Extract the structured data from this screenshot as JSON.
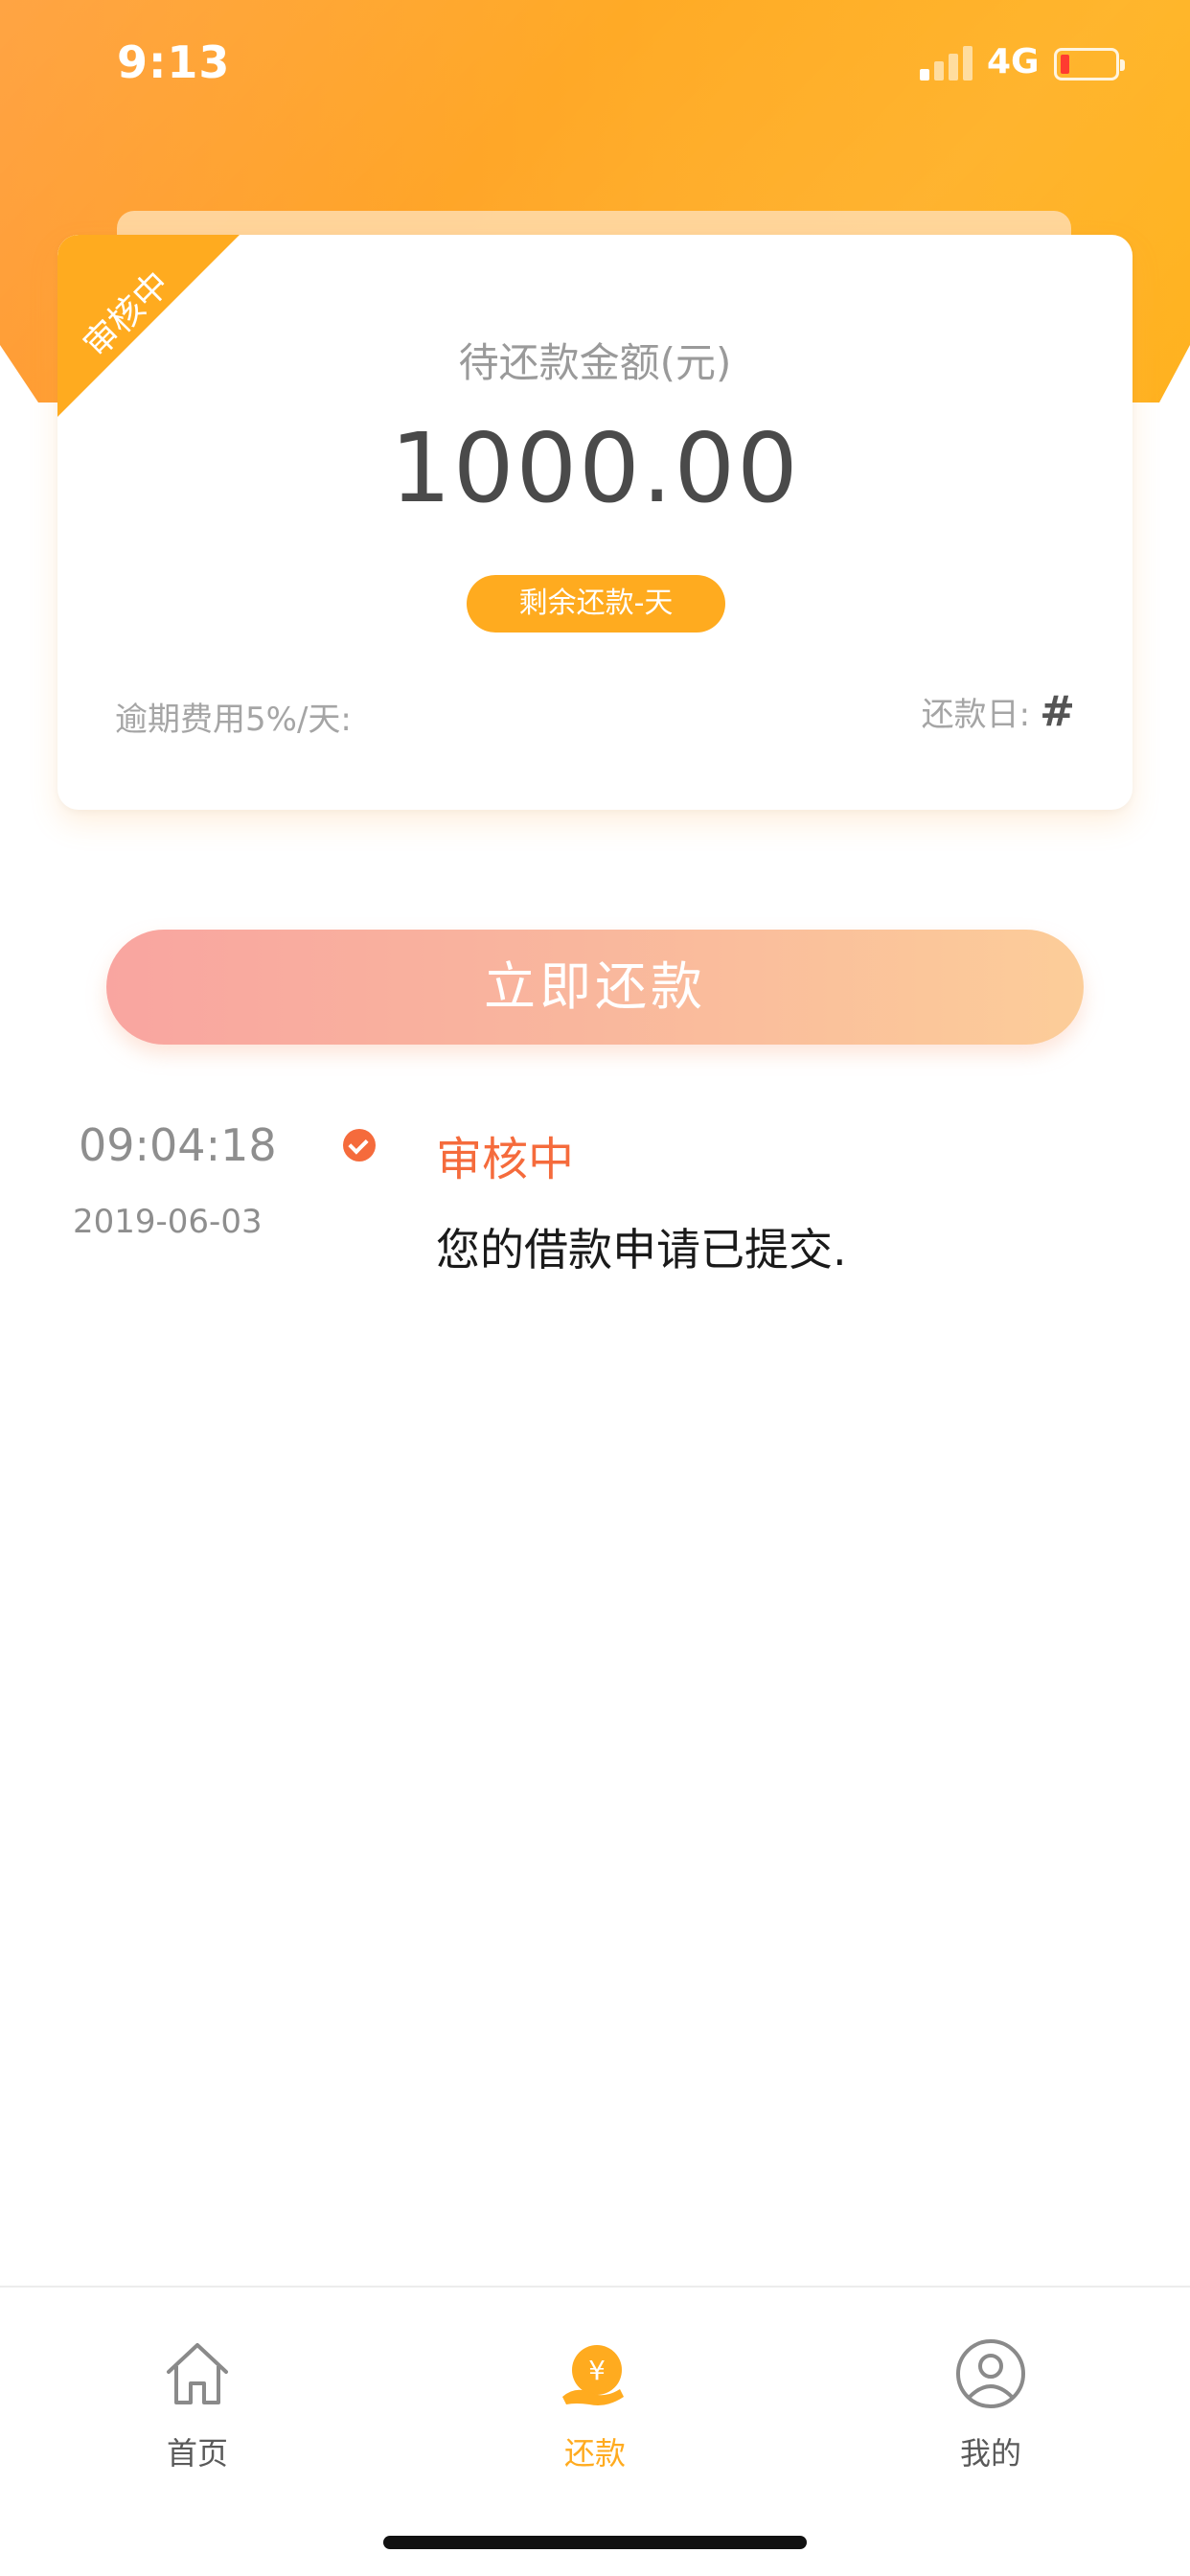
{
  "status_bar": {
    "time": "9:13",
    "network": "4G"
  },
  "card": {
    "ribbon_label": "审核中",
    "amount_label": "待还款金额(元)",
    "amount": "1000.00",
    "days_badge": "剩余还款-天",
    "overdue_label": "逾期费用5%/天:",
    "due_label": "还款日:",
    "due_value": "#"
  },
  "repay_button": {
    "label": "立即还款"
  },
  "timeline": {
    "time": "09:04:18",
    "date": "2019-06-03",
    "status": "审核中",
    "description": "您的借款申请已提交."
  },
  "tabbar": {
    "items": [
      {
        "label": "首页",
        "icon": "home-icon",
        "active": false
      },
      {
        "label": "还款",
        "icon": "repay-yen-icon",
        "active": true
      },
      {
        "label": "我的",
        "icon": "profile-icon",
        "active": false
      }
    ]
  },
  "colors": {
    "accent": "#ffab1f",
    "status": "#f56b3c"
  }
}
